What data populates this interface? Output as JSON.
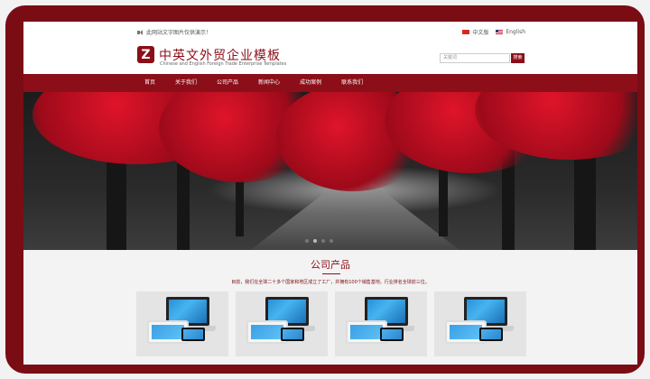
{
  "topbar": {
    "notice": "此网站文字图片仅供演示！",
    "lang_cn": "中文版",
    "lang_en": "English"
  },
  "header": {
    "logo_letter": "Z",
    "brand_cn": "中英文外贸企业模板",
    "brand_en": "Chinese and English Foreign Trade Enterprise Templates",
    "search_placeholder": "关键词",
    "search_button": "搜索"
  },
  "nav": {
    "items": [
      "首页",
      "关于我们",
      "公司产品",
      "新闻中心",
      "成功案例",
      "联系我们"
    ]
  },
  "hero": {
    "slides": 4,
    "active_slide": 1
  },
  "products": {
    "title": "公司产品",
    "description": "目前，我们在全球二十多个国家和地区成立了工厂，并拥有100个销售基地。行业排名全球前三位。",
    "items": [
      {
        "icon": "devices-product-image"
      },
      {
        "icon": "devices-product-image"
      },
      {
        "icon": "devices-product-image"
      },
      {
        "icon": "devices-product-image"
      }
    ]
  },
  "colors": {
    "brand": "#8b0e18",
    "frame": "#7a0c14"
  }
}
